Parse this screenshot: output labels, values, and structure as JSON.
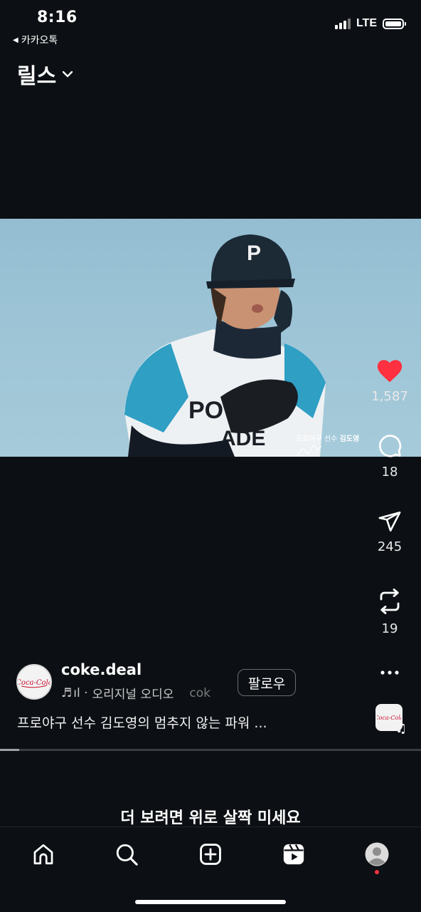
{
  "status_bar": {
    "time": "8:16",
    "back_app": "카카오톡",
    "network": "LTE",
    "signal_bars": 3,
    "battery_level": 1.0
  },
  "header": {
    "title": "릴스",
    "dropdown_icon": "chevron-down-icon"
  },
  "video": {
    "overlay_caption_prefix": "프로야구 선수 ",
    "overlay_caption_name": "김도영",
    "overlay_signature": "signature-scribble"
  },
  "actions": {
    "like_count": "1,587",
    "comment_count": "18",
    "share_count": "245",
    "remix_count": "19",
    "like_color": "#ff3040"
  },
  "author": {
    "username": "coke.deal",
    "avatar_logo": "Coca-Cola",
    "audio_prefix": "ıl · ",
    "audio_label": "오리지널 오디오",
    "audio_trailing": "cok",
    "follow_label": "팔로우"
  },
  "caption": "프로야구 선수 김도영의 멈추지 않는 파워 ...",
  "progress": 0.045,
  "swipe_hint": "더 보려면 위로 살짝 미세요",
  "bottom_nav": {
    "items": [
      "home-icon",
      "search-icon",
      "create-icon",
      "reels-icon",
      "profile-icon"
    ],
    "notification_color": "#ff3040"
  }
}
